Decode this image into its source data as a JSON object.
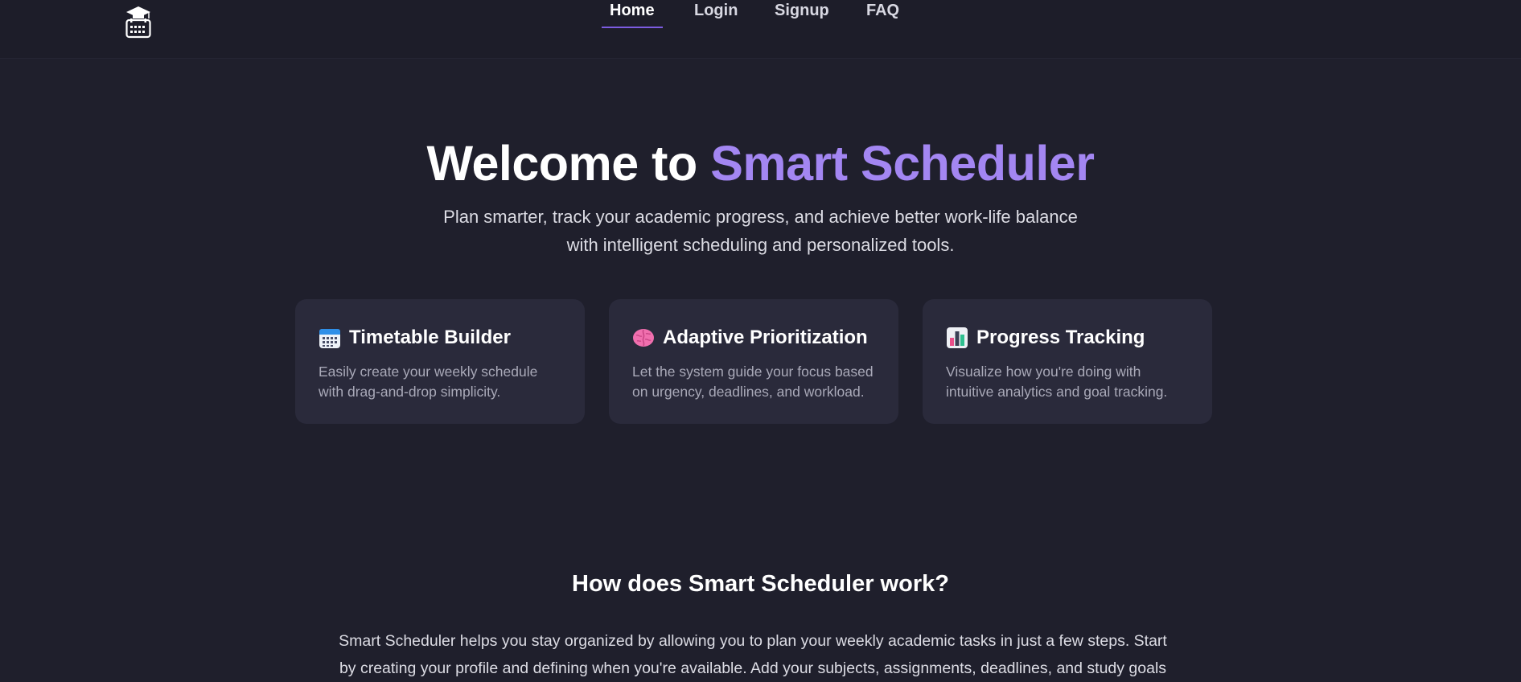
{
  "nav": {
    "logo_icon": "calendar-graduation-cap-icon",
    "links": [
      "Home",
      "Login",
      "Signup",
      "FAQ"
    ],
    "active": "Home",
    "accent_color": "#7c5ce0"
  },
  "hero": {
    "title_prefix": "Welcome to ",
    "title_accent": "Smart Scheduler",
    "accent_color": "#a386f2",
    "subtitle_line1": "Plan smarter, track your academic progress, and achieve better work-life balance",
    "subtitle_line2": "with intelligent scheduling and personalized tools."
  },
  "features": [
    {
      "icon": "calendar-icon",
      "title": "Timetable Builder",
      "desc": "Easily create your weekly schedule with drag-and-drop simplicity."
    },
    {
      "icon": "brain-icon",
      "title": "Adaptive Prioritization",
      "desc": "Let the system guide your focus based on urgency, deadlines, and workload."
    },
    {
      "icon": "bar-chart-icon",
      "title": "Progress Tracking",
      "desc": "Visualize how you're doing with intuitive analytics and goal tracking."
    }
  ],
  "how": {
    "title": "How does Smart Scheduler work?",
    "text": "Smart Scheduler helps you stay organized by allowing you to plan your weekly academic tasks in just a few steps. Start by creating your profile and defining when you're available. Add your subjects, assignments, deadlines, and study goals"
  }
}
